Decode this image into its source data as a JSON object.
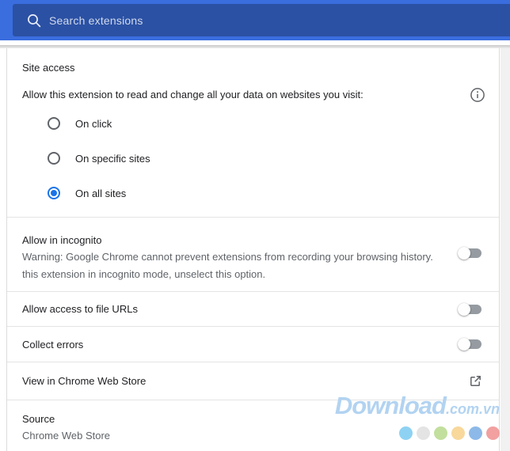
{
  "toolbar": {
    "search_placeholder": "Search extensions"
  },
  "site_access": {
    "title": "Site access",
    "description": "Allow this extension to read and change all your data on websites you visit:",
    "options": [
      {
        "label": "On click",
        "selected": false
      },
      {
        "label": "On specific sites",
        "selected": false
      },
      {
        "label": "On all sites",
        "selected": true
      }
    ]
  },
  "rows": {
    "incognito": {
      "title": "Allow in incognito",
      "warning_line1": "Warning: Google Chrome cannot prevent extensions from recording your browsing history.",
      "warning_line2": "this extension in incognito mode, unselect this option.",
      "enabled": false
    },
    "file_urls": {
      "label": "Allow access to file URLs",
      "enabled": false
    },
    "collect_errors": {
      "label": "Collect errors",
      "enabled": false
    },
    "web_store": {
      "label": "View in Chrome Web Store"
    },
    "source": {
      "label": "Source",
      "value": "Chrome Web Store"
    }
  },
  "icons": {
    "search": "search-icon",
    "info": "info-icon",
    "external": "open-in-new-icon"
  },
  "watermark": {
    "brand": "Download",
    "suffix": ".com.vn",
    "dot_colors": [
      "#8ed2f3",
      "#e4e4e4",
      "#c2df9d",
      "#f8d89b",
      "#8db9e8",
      "#f2a0a0"
    ]
  },
  "colors": {
    "header_bg": "#3a6dde",
    "field_bg": "#2b51a4",
    "accent": "#1a73e8",
    "toggle_off": "#959ba1",
    "wm_color": "#b2d3f1"
  }
}
